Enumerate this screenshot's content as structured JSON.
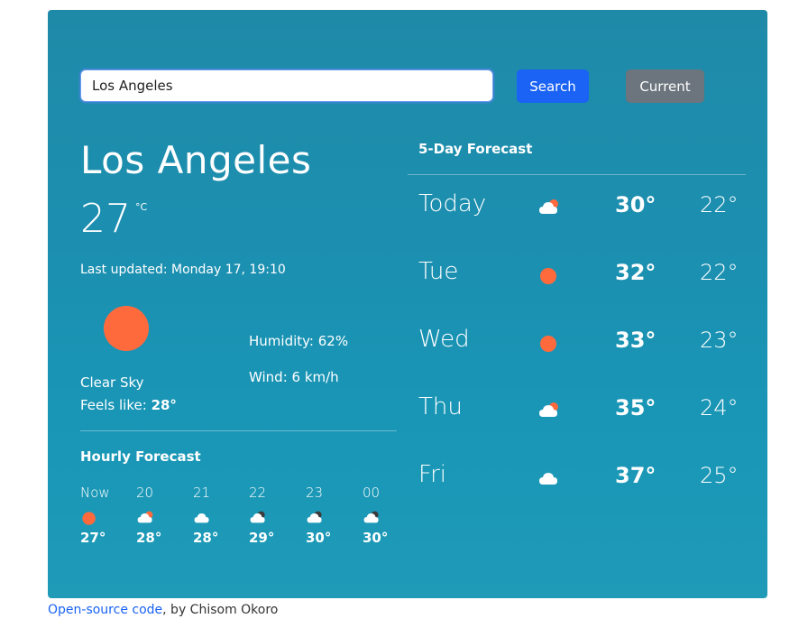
{
  "search": {
    "value": "Los Angeles",
    "button_label": "Search",
    "current_label": "Current"
  },
  "current": {
    "city": "Los Angeles",
    "temperature": "27",
    "unit": "°C",
    "last_updated": "Last updated: Monday 17, 19:10",
    "description": "Clear Sky",
    "feels_label": "Feels like: ",
    "feels_value": "28°",
    "humidity": "Humidity: 62%",
    "wind": "Wind: 6 km/h",
    "icon": "sun-icon"
  },
  "hourly": {
    "title": "Hourly Forecast",
    "items": [
      {
        "time": "Now",
        "temp": "27°",
        "icon": "sun-icon"
      },
      {
        "time": "20",
        "temp": "28°",
        "icon": "cloud-sun-icon"
      },
      {
        "time": "21",
        "temp": "28°",
        "icon": "cloud-icon"
      },
      {
        "time": "22",
        "temp": "29°",
        "icon": "cloud-moon-icon"
      },
      {
        "time": "23",
        "temp": "30°",
        "icon": "cloud-moon-icon"
      },
      {
        "time": "00",
        "temp": "30°",
        "icon": "cloud-moon-icon"
      }
    ]
  },
  "forecast": {
    "title": "5-Day Forecast",
    "days": [
      {
        "day": "Today",
        "high": "30°",
        "low": "22°",
        "icon": "cloud-sun-icon"
      },
      {
        "day": "Tue",
        "high": "32°",
        "low": "22°",
        "icon": "sun-icon"
      },
      {
        "day": "Wed",
        "high": "33°",
        "low": "23°",
        "icon": "sun-icon"
      },
      {
        "day": "Thu",
        "high": "35°",
        "low": "24°",
        "icon": "cloud-sun-icon"
      },
      {
        "day": "Fri",
        "high": "37°",
        "low": "25°",
        "icon": "cloud-icon"
      }
    ]
  },
  "footer": {
    "link_text": "Open-source code",
    "byline": ", by Chisom Okoro"
  },
  "colors": {
    "accent": "#1a63f5",
    "sun": "#ff6a3d",
    "card": "#1c8fb0",
    "secondary_button": "#6c757d"
  }
}
